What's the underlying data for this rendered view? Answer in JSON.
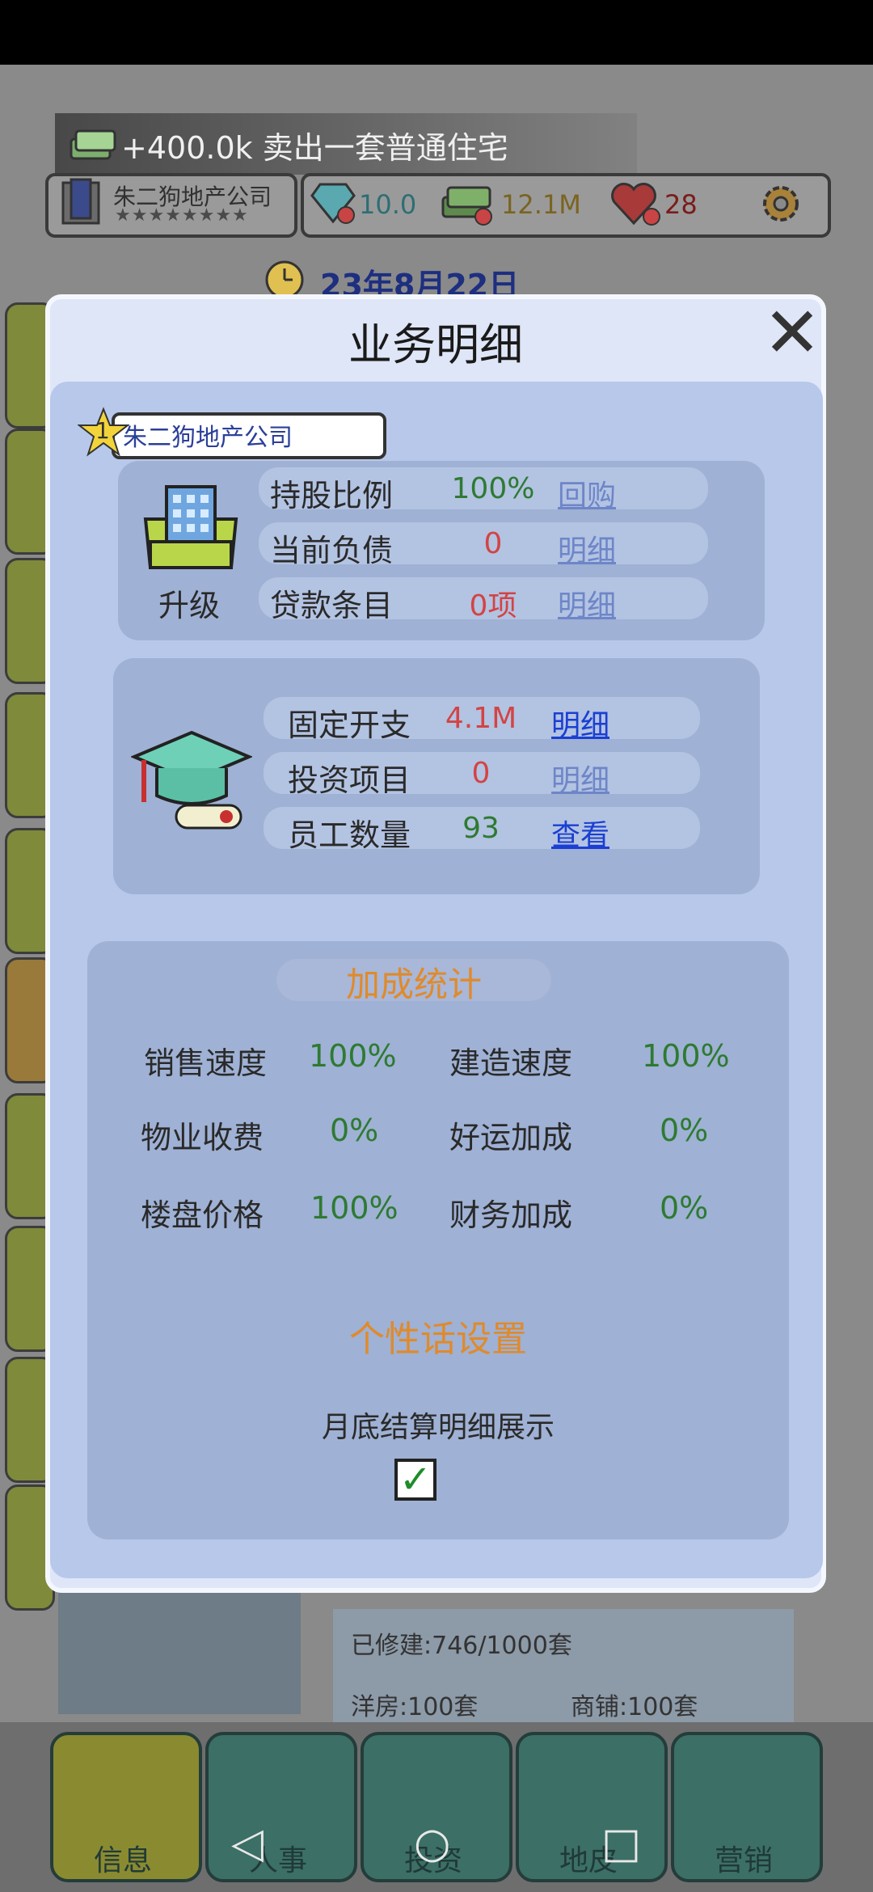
{
  "toast": {
    "text": "+400.0k 卖出一套普通住宅"
  },
  "hud": {
    "company_name": "朱二狗地产公司",
    "stars": "★★★★★★★★",
    "gems": "10.0",
    "cash": "12.1M",
    "hearts": "28",
    "date": "23年8月22日"
  },
  "dialog": {
    "title": "业务明细",
    "company": {
      "rank": "1",
      "name": "朱二狗地产公司",
      "upgrade_label": "升级"
    },
    "card1": [
      {
        "label": "持股比例",
        "value": "100%",
        "link": "回购"
      },
      {
        "label": "当前负债",
        "value": "0",
        "link": "明细"
      },
      {
        "label": "贷款条目",
        "value": "0项",
        "link": "明细"
      }
    ],
    "card2": [
      {
        "label": "固定开支",
        "value": "4.1M",
        "link": "明细"
      },
      {
        "label": "投资项目",
        "value": "0",
        "link": "明细"
      },
      {
        "label": "员工数量",
        "value": "93",
        "link": "查看"
      }
    ],
    "stats": {
      "title": "加成统计",
      "items": [
        {
          "label": "销售速度",
          "value": "100%"
        },
        {
          "label": "建造速度",
          "value": "100%"
        },
        {
          "label": "物业收费",
          "value": "0%"
        },
        {
          "label": "好运加成",
          "value": "0%"
        },
        {
          "label": "楼盘价格",
          "value": "100%"
        },
        {
          "label": "财务加成",
          "value": "0%"
        }
      ]
    },
    "personal": {
      "title": "个性话设置",
      "monthly_label": "月底结算明细展示",
      "checked": "✓"
    }
  },
  "background": {
    "built": "已修建:746/1000套",
    "villa": "洋房:100套",
    "shop": "商铺:100套"
  },
  "nav": [
    "信息",
    "人事",
    "投资",
    "地皮",
    "营销"
  ],
  "system_nav": {
    "back": "◁",
    "home": "○",
    "recent": "□"
  }
}
